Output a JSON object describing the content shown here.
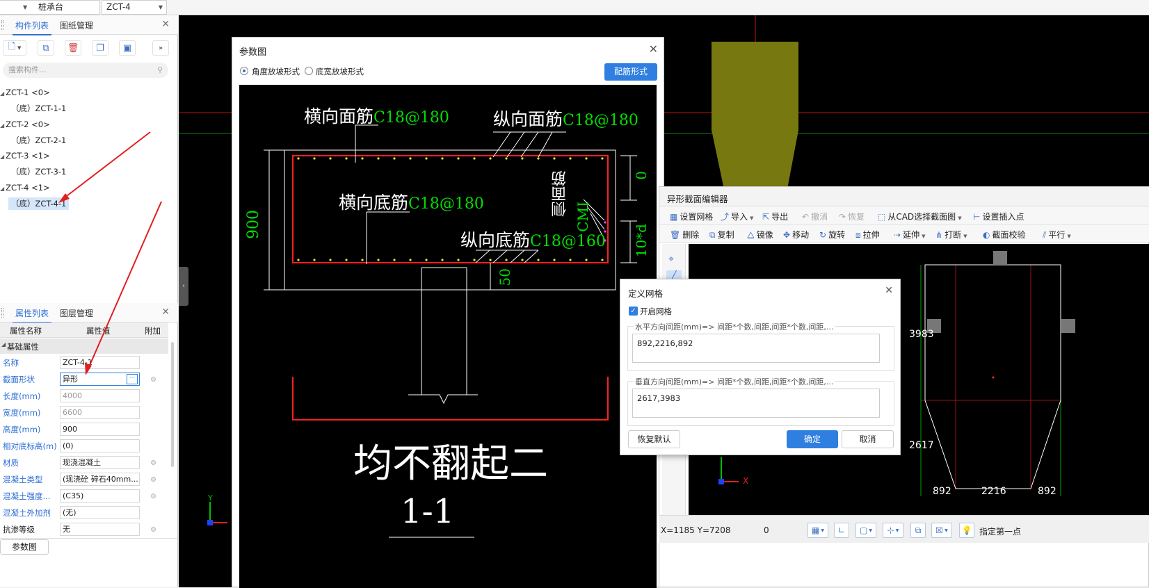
{
  "topbar": {
    "select1": "桩承台",
    "select2": "ZCT-4"
  },
  "left_top": {
    "tabs": [
      "构件列表",
      "图纸管理"
    ],
    "search_placeholder": "搜索构件...",
    "tree": [
      {
        "label": "ZCT-1 <0>",
        "child": "（底）ZCT-1-1"
      },
      {
        "label": "ZCT-2 <0>",
        "child": "（底）ZCT-2-1"
      },
      {
        "label": "ZCT-3 <1>",
        "child": "（底）ZCT-3-1"
      },
      {
        "label": "ZCT-4 <1>",
        "child": "（底）ZCT-4-1"
      }
    ]
  },
  "left_bottom": {
    "tabs": [
      "属性列表",
      "图层管理"
    ],
    "headers": [
      "属性名称",
      "属性值",
      "附加"
    ],
    "group": "基础属性",
    "rows": [
      {
        "name": "名称",
        "value": "ZCT-4-1"
      },
      {
        "name": "截面形状",
        "value": "异形"
      },
      {
        "name": "长度(mm)",
        "value": "4000"
      },
      {
        "name": "宽度(mm)",
        "value": "6600"
      },
      {
        "name": "高度(mm)",
        "value": "900"
      },
      {
        "name": "相对底标高(m)",
        "value": "(0)"
      },
      {
        "name": "材质",
        "value": "现浇混凝土"
      },
      {
        "name": "混凝土类型",
        "value": "(现浇砼 碎石40mm..."
      },
      {
        "name": "混凝土强度...",
        "value": "(C35)"
      },
      {
        "name": "混凝土外加剂",
        "value": "(无)"
      },
      {
        "name": "抗渗等级",
        "value": "无"
      }
    ],
    "bottom_button": "参数图"
  },
  "param_dialog": {
    "title": "参数图",
    "radio1": "角度放坡形式",
    "radio2": "底宽放坡形式",
    "button": "配筋形式",
    "drawing": {
      "top_transverse": "横向面筋",
      "top_transverse_val": "C18@180",
      "top_longitudinal": "纵向面筋",
      "top_longitudinal_val": "C18@180",
      "bottom_transverse": "横向底筋",
      "bottom_transverse_val": "C18@180",
      "bottom_longitudinal": "纵向底筋",
      "bottom_longitudinal_val": "C18@160",
      "side": "侧面筋",
      "side_val": "CMI",
      "dim_900": "900",
      "dim_0": "0",
      "dim_10d": "10*d",
      "dim_50": "50",
      "note": "均不翻起二",
      "section": "1-1"
    }
  },
  "editor": {
    "title": "异形截面编辑器",
    "row1": [
      "设置网格",
      "导入",
      "导出",
      "撤消",
      "恢复",
      "从CAD选择截面图",
      "设置插入点"
    ],
    "row2": [
      "删除",
      "复制",
      "镜像",
      "移动",
      "旋转",
      "拉伸",
      "延伸",
      "打断",
      "截面校验",
      "平行"
    ],
    "dims": {
      "h1": "3983",
      "h2": "2617",
      "w1": "892",
      "w2": "2216",
      "w3": "892"
    },
    "coord": "X=1185 Y=7208",
    "zero": "0",
    "status_text": "指定第一点"
  },
  "grid_dialog": {
    "title": "定义网格",
    "checkbox": "开启网格",
    "h_legend": "水平方向间距(mm)=> 间距*个数,间距,间距*个数,间距,...",
    "h_value": "892,2216,892",
    "v_legend": "垂直方向间距(mm)=> 间距*个数,间距,间距*个数,间距,...",
    "v_value": "2617,3983",
    "restore": "恢复默认",
    "ok": "确定",
    "cancel": "取消"
  },
  "canvas": {
    "axis_x": "X",
    "axis_y": "Y"
  },
  "colors": {
    "accent": "#2f7fe0",
    "rebar_green": "#00e000",
    "rebar_red": "#ff2020",
    "olive": "#7a7a10"
  }
}
